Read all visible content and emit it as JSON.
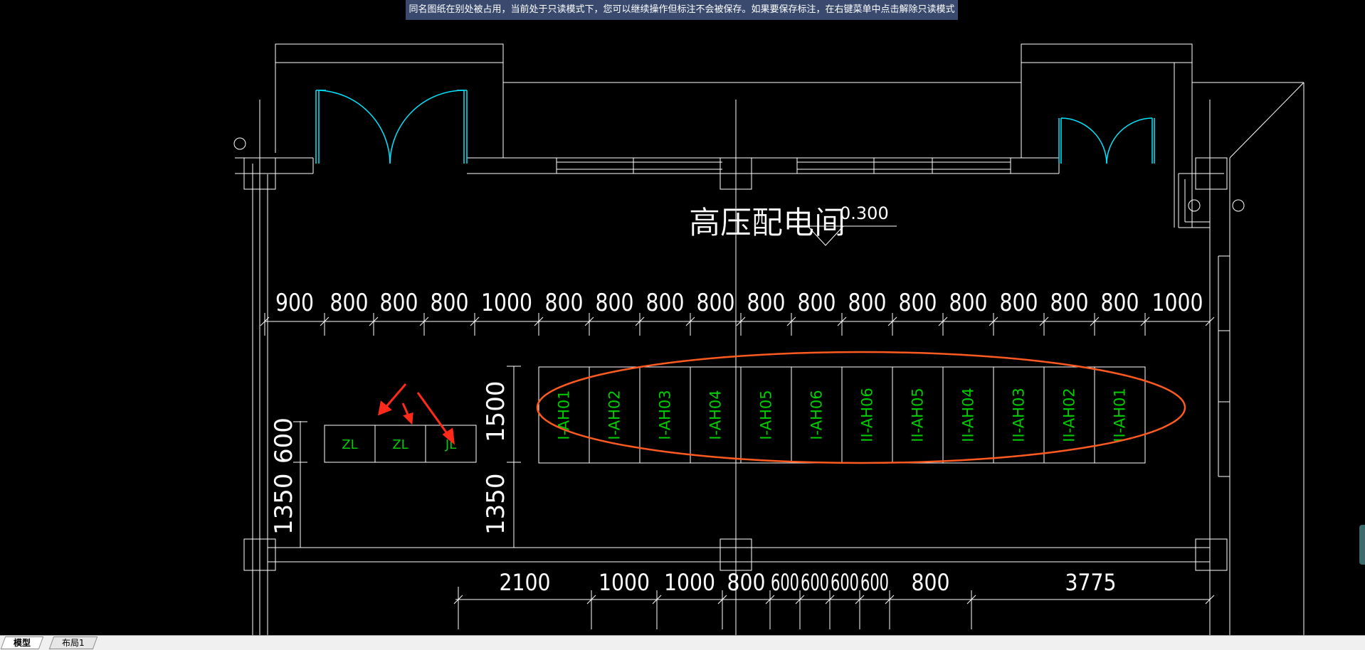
{
  "banner": {
    "message": "同名图纸在别处被占用，当前处于只读模式下，您可以继续操作但标注不会被保存。如果要保存标注，在右键菜单中点击解除只读模式"
  },
  "drawing": {
    "room_title": "高压配电间",
    "elevation": "0.300",
    "top_dims": [
      "900",
      "800",
      "800",
      "800",
      "1000",
      "800",
      "800",
      "800",
      "800",
      "800",
      "800",
      "800",
      "800",
      "800",
      "800",
      "800",
      "800",
      "1000"
    ],
    "bottom_dims": [
      "2100",
      "1000",
      "1000",
      "800",
      "600",
      "600",
      "600",
      "600",
      "800",
      "3775"
    ],
    "left_dims": {
      "small_cabinet_depth": "600",
      "front_clearance_left": "1350",
      "hv_cabinet_depth": "1500",
      "front_clearance_hv": "1350"
    },
    "dc_cabinets": [
      "ZL",
      "ZL",
      "JL"
    ],
    "hv_cabinets": [
      "I-AH01",
      "I-AH02",
      "I-AH03",
      "I-AH04",
      "I-AH05",
      "I-AH06",
      "II-AH06",
      "II-AH05",
      "II-AH04",
      "II-AH03",
      "II-AH02",
      "II-AH01"
    ]
  },
  "colors": {
    "lines": "#ffffff",
    "doors": "#00e5ff",
    "cabinet_text": "#00cc00",
    "annotation": "#ff5a1f",
    "arrows": "#ff2a1a",
    "background": "#000000"
  },
  "tabs": [
    {
      "label": "模型",
      "active": true
    },
    {
      "label": "布局1",
      "active": false
    }
  ]
}
